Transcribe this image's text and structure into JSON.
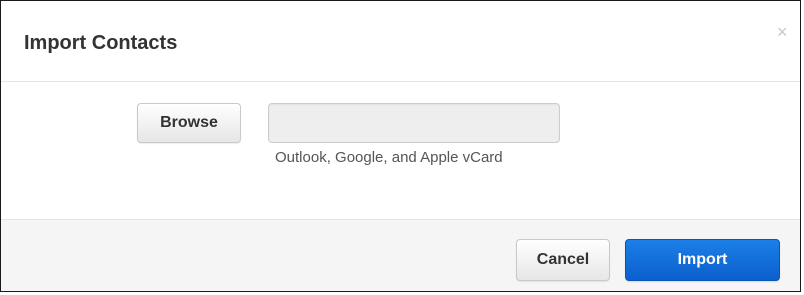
{
  "dialog": {
    "title": "Import Contacts",
    "close_glyph": "×",
    "close_icon": "close-icon"
  },
  "file_picker": {
    "browse_label": "Browse",
    "file_value": "",
    "helper_text": "Outlook, Google, and Apple vCard"
  },
  "footer": {
    "cancel_label": "Cancel",
    "import_label": "Import"
  },
  "colors": {
    "primary": "#0b6ad9",
    "footer_bg": "#f5f5f5",
    "input_bg": "#eeeeee"
  }
}
